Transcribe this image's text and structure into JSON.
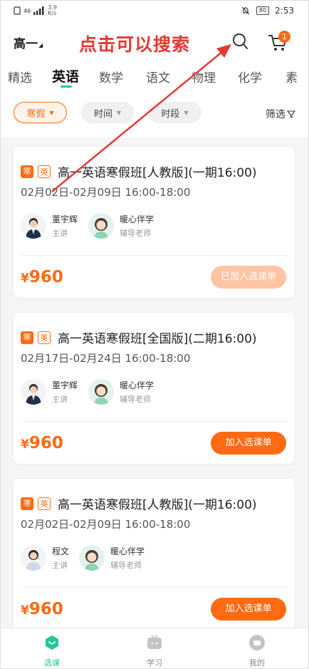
{
  "status_bar": {
    "network": "46",
    "speed": "3.9",
    "speed_unit": "K/s",
    "battery": "80",
    "time": "2:53"
  },
  "header": {
    "grade": "高一",
    "annotation": "点击可以搜索",
    "cart_count": "1"
  },
  "tabs": [
    "精选",
    "英语",
    "数学",
    "语文",
    "物理",
    "化学",
    "素"
  ],
  "active_tab": "英语",
  "filters": {
    "chips": [
      "寒假",
      "时间",
      "时段"
    ],
    "filter_label": "筛选"
  },
  "cards": [
    {
      "tag_season": "寒",
      "tag_subject": "英",
      "title": "高一英语寒假班[人教版](一期16:00)",
      "date": "02月02日-02月09日 16:00-18:00",
      "teacher_name": "董宇辉",
      "teacher_role": "主讲",
      "tutor_name": "暖心伴学",
      "tutor_role": "辅导老师",
      "price_symbol": "¥",
      "price": "960",
      "action": "已加入选课单"
    },
    {
      "tag_season": "寒",
      "tag_subject": "英",
      "title": "高一英语寒假班[全国版](二期16:00)",
      "date": "02月17日-02月24日 16:00-18:00",
      "teacher_name": "董宇辉",
      "teacher_role": "主讲",
      "tutor_name": "暖心伴学",
      "tutor_role": "辅导老师",
      "price_symbol": "¥",
      "price": "960",
      "action": "加入选课单"
    },
    {
      "tag_season": "寒",
      "tag_subject": "英",
      "title": "高一英语寒假班[人教版](一期16:00)",
      "date": "02月02日-02月09日 16:00-18:00",
      "teacher_name": "程文",
      "teacher_role": "主讲",
      "tutor_name": "暖心伴学",
      "tutor_role": "辅导老师",
      "price_symbol": "¥",
      "price": "960",
      "action": "加入选课单"
    }
  ],
  "bottom_nav": [
    "选课",
    "学习",
    "我的"
  ],
  "colors": {
    "accent_orange": "#ff6a13",
    "accent_green": "#20c997",
    "annotation_red": "#e53935"
  }
}
